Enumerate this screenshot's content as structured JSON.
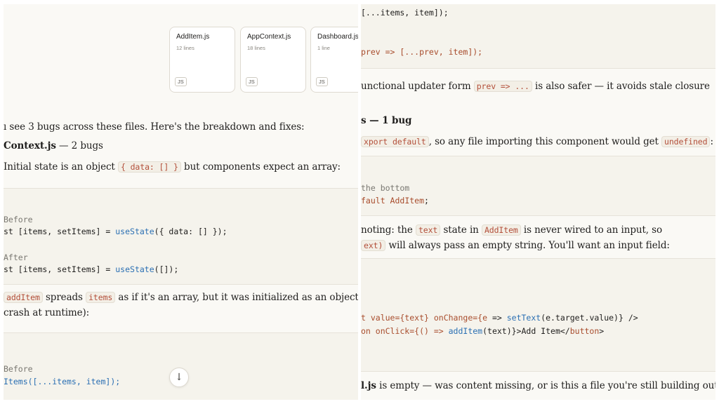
{
  "left": {
    "attachments": [
      {
        "name": "AddItem.js",
        "lines": "12 lines",
        "badge": "JS"
      },
      {
        "name": "AppContext.js",
        "lines": "18 lines",
        "badge": "JS"
      },
      {
        "name": "Dashboard.js",
        "lines": "1 line",
        "badge": "JS"
      }
    ],
    "intro": "ı see 3 bugs across these files. Here's the breakdown and fixes:",
    "heading_file": "Context.js",
    "heading_rest": " — 2 bugs",
    "para1_pre": "Initial state is an object ",
    "para1_code": "{ data: [] }",
    "para1_post": " but components expect an array:",
    "code1": {
      "before_label": "Before",
      "before_prefix": "st [items, setItems] = ",
      "before_fn": "useState",
      "before_suffix": "({ data: [] });",
      "after_label": "After",
      "after_prefix": "st [items, setItems] = ",
      "after_fn": "useState",
      "after_suffix": "([]);"
    },
    "para2_code1": "addItem",
    "para2_mid1": " spreads ",
    "para2_code2": "items",
    "para2_line1_rest": " as if it's an array, but it was initialized as an object (would",
    "para2_line2": "crash at runtime):",
    "code2": {
      "before_label": "Before",
      "line": "Items([...items, item]);"
    },
    "scroll_icon": "↓"
  },
  "right": {
    "code_top_1": "[...items, item]);",
    "code_top_2": "prev => [...prev, item]);",
    "para1_pre": "unctional updater form ",
    "para1_code": "prev => ...",
    "para1_post": " is also safer — it avoids stale closure",
    "heading": "s — 1 bug",
    "para2_code1": "xport default",
    "para2_mid": ", so any file importing this component would get ",
    "para2_code2": "undefined",
    "para2_end": ":",
    "code1": {
      "comment": " the bottom",
      "kw": "fault ",
      "name": "AddItem",
      "end": ";"
    },
    "para3_pre": " noting: the ",
    "para3_code1": "text",
    "para3_mid": " state in ",
    "para3_code2": "AddItem",
    "para3_post": " is never wired to an input, so",
    "para3_line2_code": "ext)",
    "para3_line2_rest": " will always pass an empty string. You'll want an input field:",
    "code2": {
      "l1_a": "t value={text} onChange={",
      "l1_b": "e",
      "l1_c": " => ",
      "l1_d": "setText",
      "l1_e": "(e.target.value)} />",
      "l2_a": "on onClick={() => ",
      "l2_b": "addItem",
      "l2_c": "(text)}>Add Item</",
      "l2_d": "button",
      "l2_e": ">"
    },
    "final_bold": "l.js",
    "final_rest": " is empty — was content missing, or is this a file you're still building out?"
  }
}
